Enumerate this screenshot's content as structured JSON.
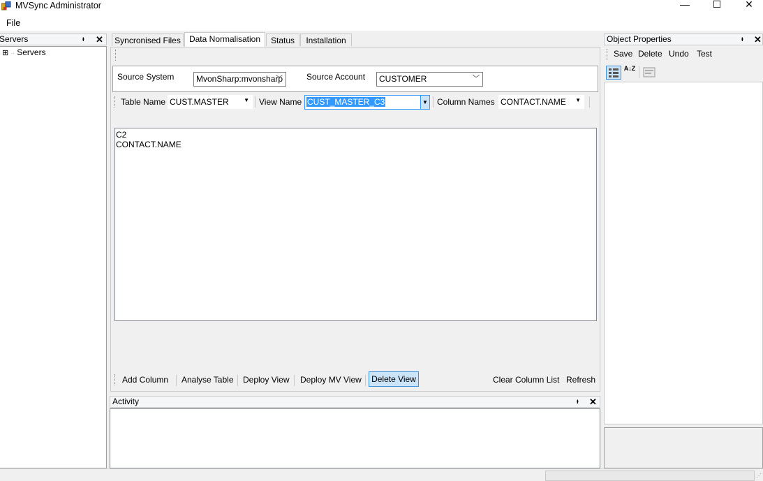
{
  "window": {
    "title": "MVSync Administrator",
    "minimize_glyph": "—",
    "maximize_glyph": "☐",
    "close_glyph": "✕"
  },
  "menu": {
    "file": "File"
  },
  "servers_panel": {
    "title": "Servers",
    "pin_glyph": "ᵻ",
    "close_glyph": "✕",
    "tree": [
      {
        "expander": "⊞",
        "label": "Servers"
      }
    ]
  },
  "tabs": [
    {
      "label": "Syncronised Files",
      "active": false
    },
    {
      "label": "Data Normalisation",
      "active": true
    },
    {
      "label": "Status",
      "active": false
    },
    {
      "label": "Installation",
      "active": false
    }
  ],
  "source": {
    "system_label": "Source System",
    "system_value": "MvonSharp:mvonsharp",
    "account_label": "Source Account",
    "account_value": "CUSTOMER"
  },
  "toolbar": {
    "table_label": "Table Name",
    "table_value": "CUST.MASTER",
    "view_label": "View Name",
    "view_value": "CUST_MASTER_C3",
    "columns_label": "Column Names",
    "columns_value": "CONTACT.NAME"
  },
  "columns_list": [
    "C2",
    "CONTACT.NAME"
  ],
  "bottom_toolbar": {
    "add_column": "Add Column",
    "analyse_table": "Analyse Table",
    "deploy_view": "Deploy View",
    "deploy_mv_view": "Deploy MV View",
    "delete_view": "Delete View",
    "clear_column_list": "Clear Column List",
    "refresh": "Refresh"
  },
  "activity_panel": {
    "title": "Activity"
  },
  "object_properties": {
    "title": "Object Properties",
    "save": "Save",
    "delete": "Delete",
    "undo": "Undo",
    "test": "Test",
    "sort_az_glyph": "A↓Z"
  },
  "colors": {
    "selection": "#3399ff",
    "hover_button": "#cce4f7",
    "panel_border": "#a0a0a0"
  }
}
